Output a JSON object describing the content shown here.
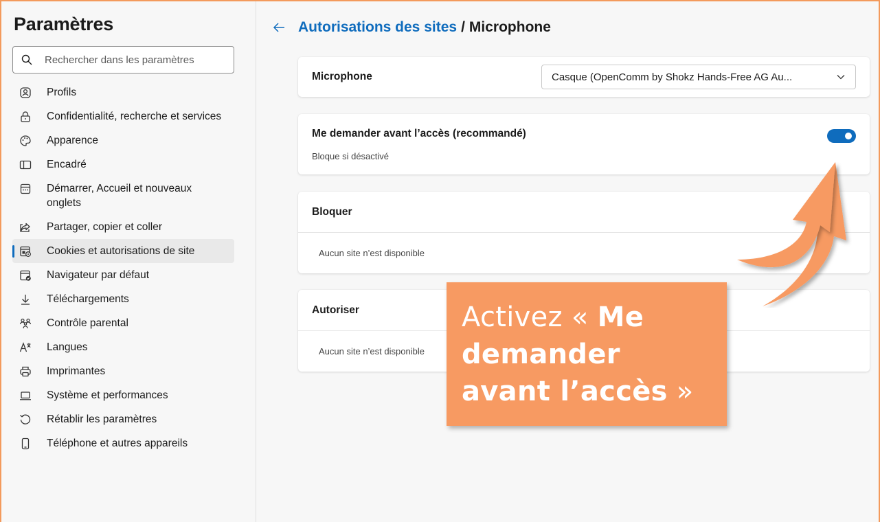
{
  "sidebar": {
    "title": "Paramètres",
    "search_placeholder": "Rechercher dans les paramètres",
    "items": [
      {
        "label": "Profils",
        "icon": "profile-icon"
      },
      {
        "label": "Confidentialité, recherche et services",
        "icon": "lock-icon"
      },
      {
        "label": "Apparence",
        "icon": "palette-icon"
      },
      {
        "label": "Encadré",
        "icon": "sidebar-panel-icon"
      },
      {
        "label": "Démarrer, Accueil et nouveaux onglets",
        "icon": "home-tab-icon"
      },
      {
        "label": "Partager, copier et coller",
        "icon": "share-icon"
      },
      {
        "label": "Cookies et autorisations de site",
        "icon": "cookies-icon",
        "active": true
      },
      {
        "label": "Navigateur par défaut",
        "icon": "default-browser-icon"
      },
      {
        "label": "Téléchargements",
        "icon": "download-icon"
      },
      {
        "label": "Contrôle parental",
        "icon": "family-icon"
      },
      {
        "label": "Langues",
        "icon": "language-icon"
      },
      {
        "label": "Imprimantes",
        "icon": "printer-icon"
      },
      {
        "label": "Système et performances",
        "icon": "laptop-icon"
      },
      {
        "label": "Rétablir les paramètres",
        "icon": "reset-icon"
      },
      {
        "label": "Téléphone et autres appareils",
        "icon": "phone-icon"
      }
    ]
  },
  "header": {
    "breadcrumb_link": "Autorisations des sites",
    "separator": "/",
    "current": "Microphone"
  },
  "microphone_card": {
    "label": "Microphone",
    "selected_device": "Casque (OpenComm by Shokz Hands-Free AG Au..."
  },
  "ask_card": {
    "label": "Me demander avant l’accès (recommandé)",
    "sublabel": "Bloque si désactivé",
    "toggle_on": true
  },
  "block_card": {
    "label": "Bloquer",
    "empty": "Aucun site n’est disponible"
  },
  "allow_card": {
    "label": "Autoriser",
    "empty": "Aucun site n’est disponible"
  },
  "callout": {
    "prefix": "Activez « ",
    "bold": "Me demander avant l’accès",
    "suffix": " »"
  },
  "colors": {
    "accent": "#0f6cbd",
    "callout": "#f79a62",
    "frame": "#f39a5c"
  }
}
